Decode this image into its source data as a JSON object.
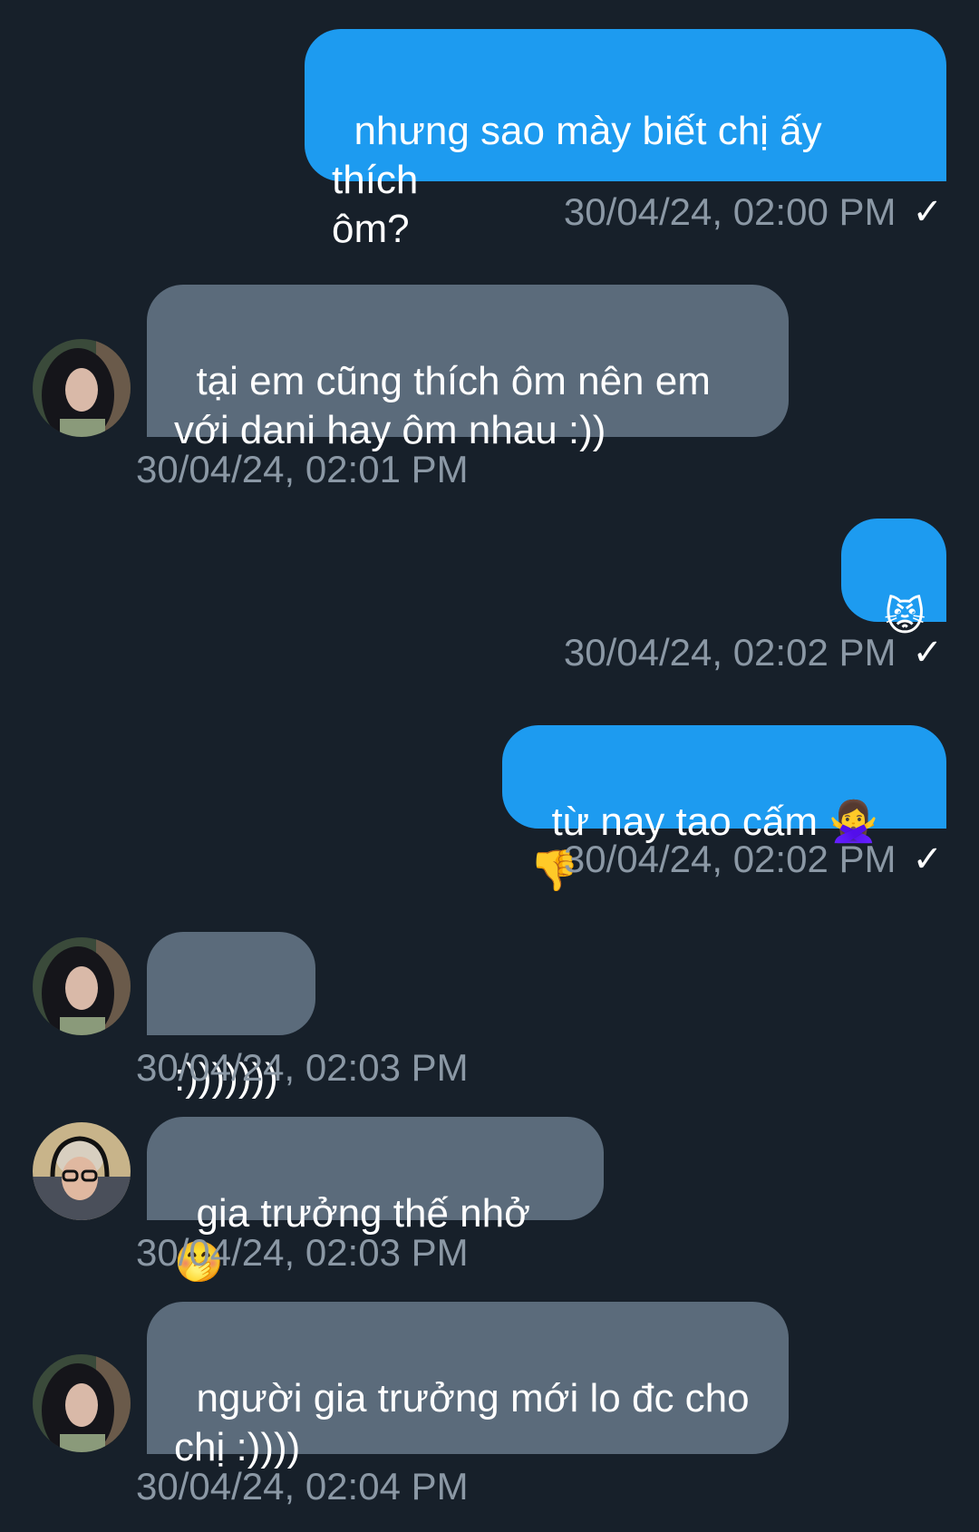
{
  "messages": [
    {
      "text": "nhưng sao mày biết chị ấy thích\nôm?",
      "time": "30/04/24, 02:00 PM"
    },
    {
      "text": "tại em cũng thích ôm nên em\nvới dani hay ôm nhau :))",
      "time": "30/04/24, 02:01 PM"
    },
    {
      "text": "😾",
      "time": "30/04/24, 02:02 PM"
    },
    {
      "text": "từ nay tao cấm 🙅‍♀️👎",
      "time": "30/04/24, 02:02 PM"
    },
    {
      "text": ":)))))))",
      "time": "30/04/24, 02:03 PM"
    },
    {
      "text": "gia trưởng thế nhở 🤭",
      "time": "30/04/24, 02:03 PM"
    },
    {
      "text": "người gia trưởng mới lo đc cho\nchị :))))",
      "time": "30/04/24, 02:04 PM"
    }
  ],
  "icons": {
    "read_check": "✓",
    "avatar_a": "avatar-long-black-hair",
    "avatar_b": "avatar-headphones-glasses"
  },
  "colors": {
    "background": "#17202a",
    "sent_bubble": "#1d9bf0",
    "received_bubble": "#5b6b7b",
    "timestamp": "#8b98a5"
  }
}
